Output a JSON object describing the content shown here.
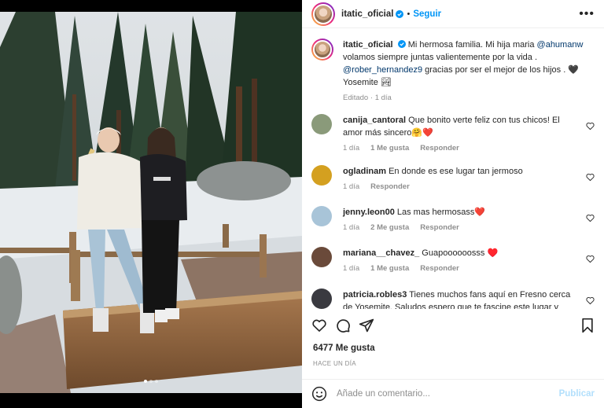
{
  "post": {
    "username": "itatic_oficial",
    "follow_label": "Seguir",
    "more_label": "•••",
    "carousel": {
      "count": 3,
      "active": 1
    }
  },
  "caption": {
    "username": "itatic_oficial",
    "text_1": "Mi hermosa familia. Mi hija maria ",
    "mention_1": "@ahumanw",
    "text_2": " volamos siempre juntas valientemente por la vida . ",
    "mention_2": "@rober_hernandez9",
    "text_3": " gracias por ser el mejor de los hijos . 🖤 Yosemite 🏞",
    "edited": "Editado",
    "time": "1 día"
  },
  "comments": [
    {
      "username": "canija_cantoral",
      "text": "Que bonito verte feliz con tus chicos! El amor más sincero🤗❤️",
      "time": "1 día",
      "likes": "1 Me gusta",
      "reply": "Responder",
      "avatar_color": "#8a9a7a"
    },
    {
      "username": "ogladinam",
      "text": "En donde es ese lugar tan jermoso",
      "time": "1 día",
      "likes": "",
      "reply": "Responder",
      "avatar_color": "#d4a020"
    },
    {
      "username": "jenny.leon00",
      "text": "Las mas hermosass❤️",
      "time": "1 día",
      "likes": "2 Me gusta",
      "reply": "Responder",
      "avatar_color": "#a8c4d8"
    },
    {
      "username": "mariana__chavez_",
      "text": "Guapoooooosss ♥️",
      "time": "1 día",
      "likes": "1 Me gusta",
      "reply": "Responder",
      "avatar_color": "#6a4a3a"
    },
    {
      "username": "patricia.robles3",
      "text": "Tienes muchos fans aquí en Fresno cerca de Yosemite. Saludos espero que te fascine este lugar y",
      "time": "",
      "likes": "",
      "reply": "",
      "avatar_color": "#3a3a40"
    }
  ],
  "footer": {
    "likes": "6477 Me gusta",
    "ago": "HACE UN DÍA",
    "comment_placeholder": "Añade un comentario...",
    "publish_label": "Publicar"
  },
  "colors": {
    "accent": "#0095f6",
    "text": "#262626",
    "muted": "#8e8e8e",
    "mention": "#00376b",
    "heart_red": "#ed4956"
  }
}
